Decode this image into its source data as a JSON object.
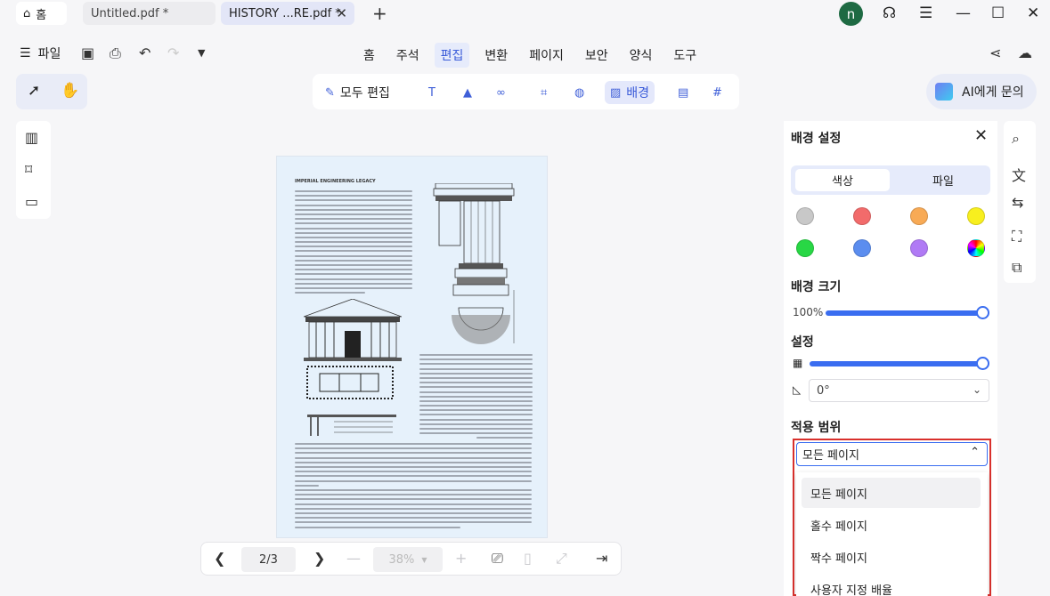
{
  "tabs": {
    "home": "홈",
    "tab1": "Untitled.pdf *",
    "tab2": "HISTORY ...RE.pdf *",
    "avatar_letter": "n"
  },
  "menubar": {
    "file": "파일",
    "items": [
      "홈",
      "주석",
      "편집",
      "변환",
      "페이지",
      "보안",
      "양식",
      "도구"
    ],
    "active": "편집"
  },
  "toolbar": {
    "edit_all": "모두 편집",
    "background": "배경",
    "ai": "AI에게 문의"
  },
  "document": {
    "title": "IMPERIAL ENGINEERING LEGACY"
  },
  "bottom": {
    "page": "2/3",
    "zoom": "38%"
  },
  "panel": {
    "title": "배경 설정",
    "seg_color": "색상",
    "seg_file": "파일",
    "colors": [
      "#c8c8c8",
      "#f26b6b",
      "#f8aa55",
      "#f8ef1e",
      "#28d745",
      "#5b8def",
      "#b07af5",
      "rainbow"
    ],
    "size_label": "배경 크기",
    "size_value": "100%",
    "size_fraction": 1.0,
    "settings_label": "설정",
    "opacity_fraction": 1.0,
    "angle_value": "0°",
    "range_label": "적용 범위",
    "range_selected": "모든 페이지",
    "range_options": [
      "모든 페이지",
      "홀수 페이지",
      "짝수 페이지",
      "사용자 지정 배율"
    ]
  }
}
